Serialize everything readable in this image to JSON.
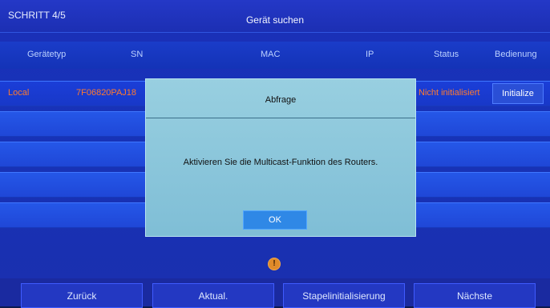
{
  "header": {
    "step": "SCHRITT 4/5",
    "title": "Gerät suchen"
  },
  "table": {
    "columns": [
      "Gerätetyp",
      "SN",
      "MAC",
      "IP",
      "Status",
      "Bedienung"
    ],
    "rows": [
      {
        "type": "Local",
        "sn": "7F06820PAJ18",
        "status": "Nicht initialisiert",
        "action": "Initialize"
      }
    ]
  },
  "dialog": {
    "title": "Abfrage",
    "message": "Aktivieren Sie die Multicast-Funktion des Routers.",
    "ok_label": "OK"
  },
  "footer": {
    "back_label": "Zurück",
    "refresh_label": "Aktual.",
    "batch_label": "Stapelinitialisierung",
    "next_label": "Nächste"
  },
  "warning_icon": "!",
  "colors": {
    "accent": "#2f88e6",
    "status": "#ff7a2e",
    "background": "#1b2fb7"
  }
}
